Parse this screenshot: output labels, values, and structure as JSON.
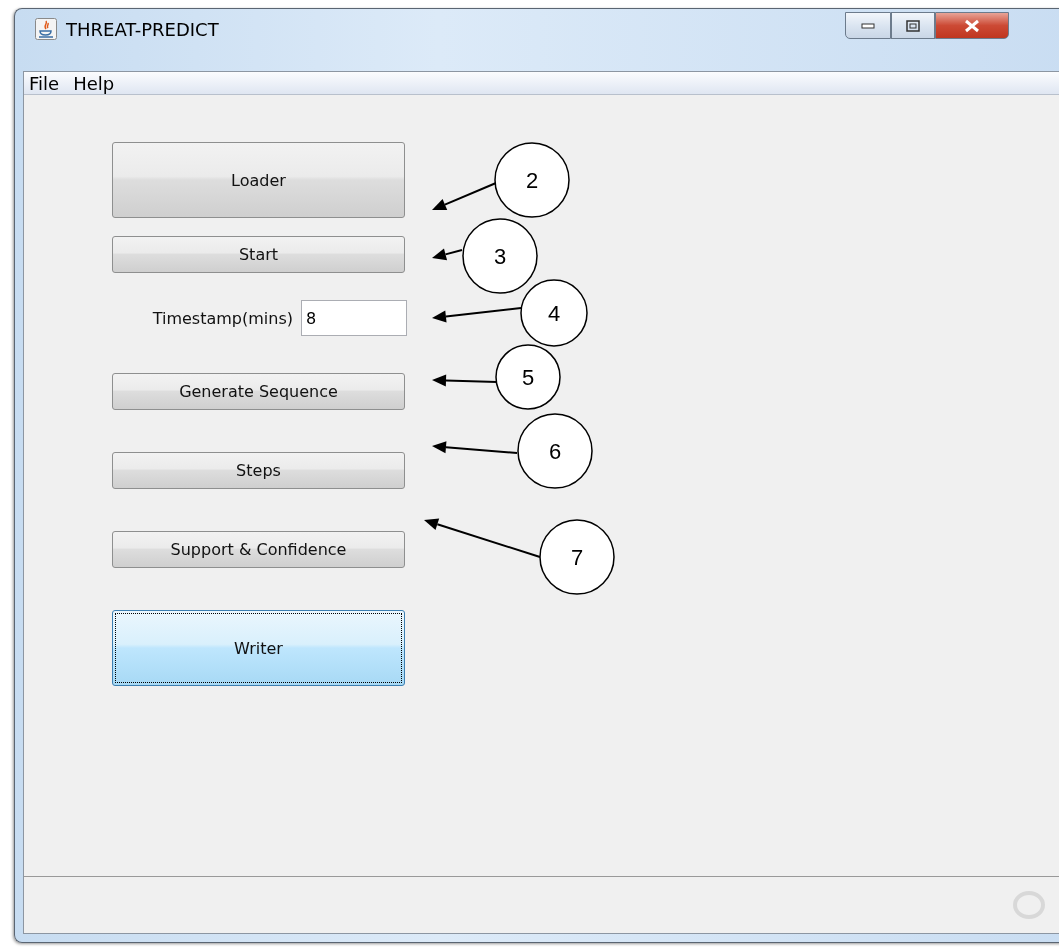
{
  "window": {
    "title": "THREAT-PREDICT"
  },
  "menu": [
    "File",
    "Help"
  ],
  "controls": [
    {
      "kind": "button",
      "label": "Loader",
      "tall": true,
      "focused": false
    },
    {
      "kind": "button",
      "label": "Start",
      "tall": false,
      "focused": false
    },
    {
      "kind": "field",
      "label": "Timestamp(mins)",
      "value": "8"
    },
    {
      "kind": "button",
      "label": "Generate Sequence",
      "tall": false,
      "focused": false
    },
    {
      "kind": "button",
      "label": "Steps",
      "tall": false,
      "focused": false
    },
    {
      "kind": "button",
      "label": "Support & Confidence",
      "tall": false,
      "focused": false
    },
    {
      "kind": "button",
      "label": "Writer",
      "tall": true,
      "focused": true
    }
  ],
  "callouts": [
    {
      "label": "2"
    },
    {
      "label": "3"
    },
    {
      "label": "4"
    },
    {
      "label": "5"
    },
    {
      "label": "6"
    },
    {
      "label": "7"
    }
  ]
}
